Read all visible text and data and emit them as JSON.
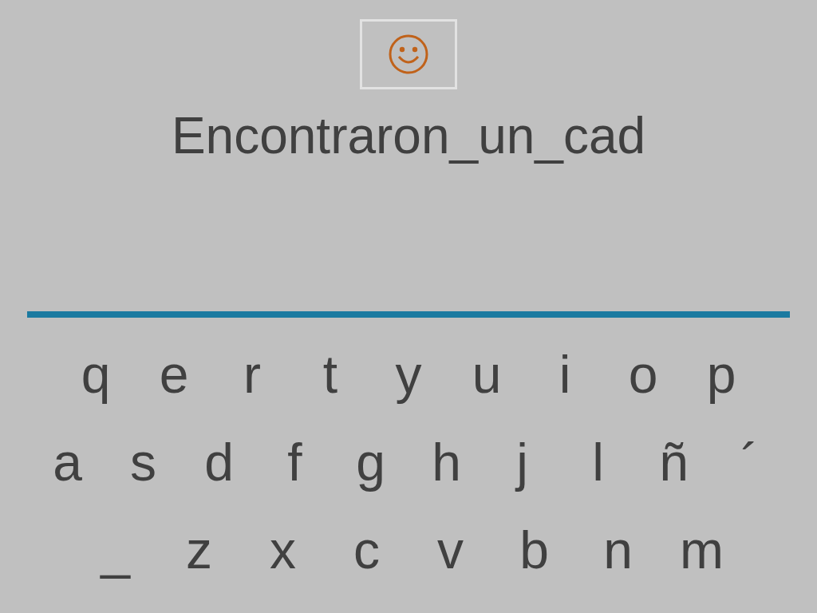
{
  "phrase": "Encontraron_un_cad",
  "keyboard_rows": [
    [
      "q",
      "e",
      "r",
      "t",
      "y",
      "u",
      "i",
      "o",
      "p"
    ],
    [
      "a",
      "s",
      "d",
      "f",
      "g",
      "h",
      "j",
      "l",
      "ñ",
      "´"
    ],
    [
      "_",
      "z",
      "x",
      "c",
      "v",
      "b",
      "n",
      "m"
    ]
  ]
}
